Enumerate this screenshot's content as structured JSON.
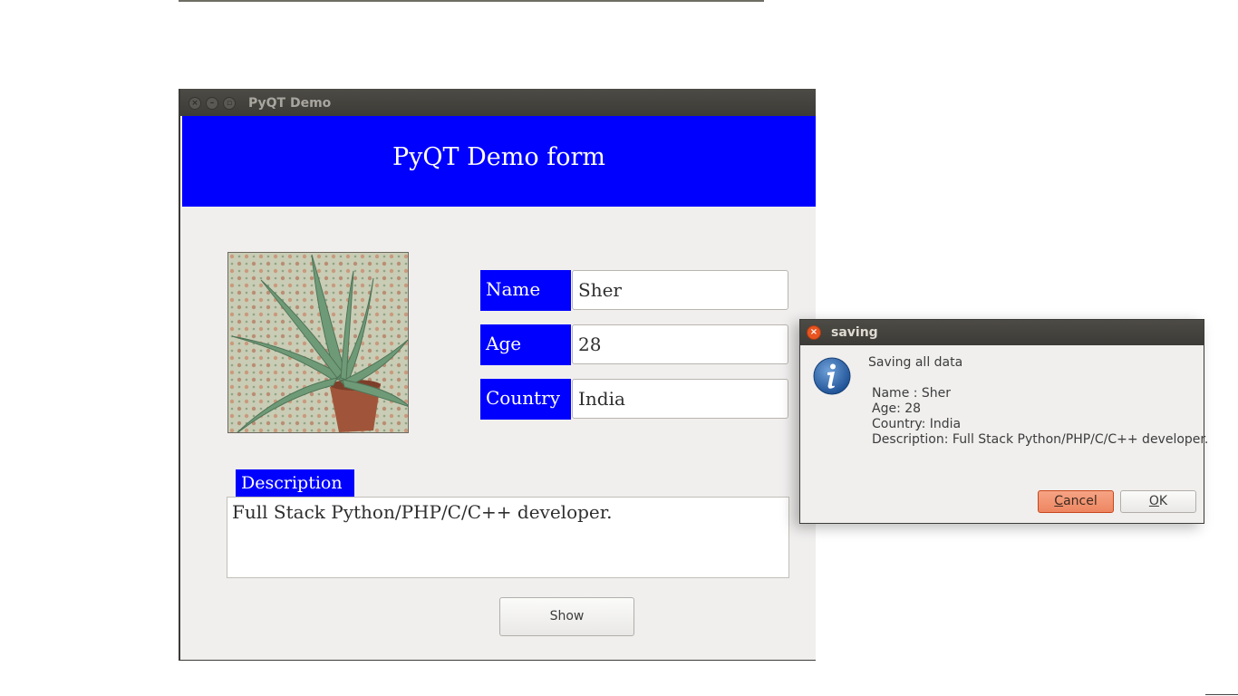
{
  "main_window": {
    "title": "PyQT Demo",
    "header": "PyQT Demo form",
    "fields": [
      {
        "label": "Name",
        "value": "Sher"
      },
      {
        "label": "Age",
        "value": "28"
      },
      {
        "label": "Country",
        "value": "India"
      }
    ],
    "description_label": "Description",
    "description_value": "Full Stack Python/PHP/C/C++ developer.",
    "show_button": "Show",
    "header_color": "#0000ff"
  },
  "dialog": {
    "title": "saving",
    "message": "Saving all data",
    "details": [
      "Name : Sher",
      "Age: 28",
      "Country: India",
      "Description: Full Stack Python/PHP/C/C++ developer."
    ],
    "cancel_first": "C",
    "cancel_rest": "ancel",
    "ok_first": "O",
    "ok_rest": "K",
    "icon": "info-icon",
    "cancel_color": "#ee8661"
  }
}
